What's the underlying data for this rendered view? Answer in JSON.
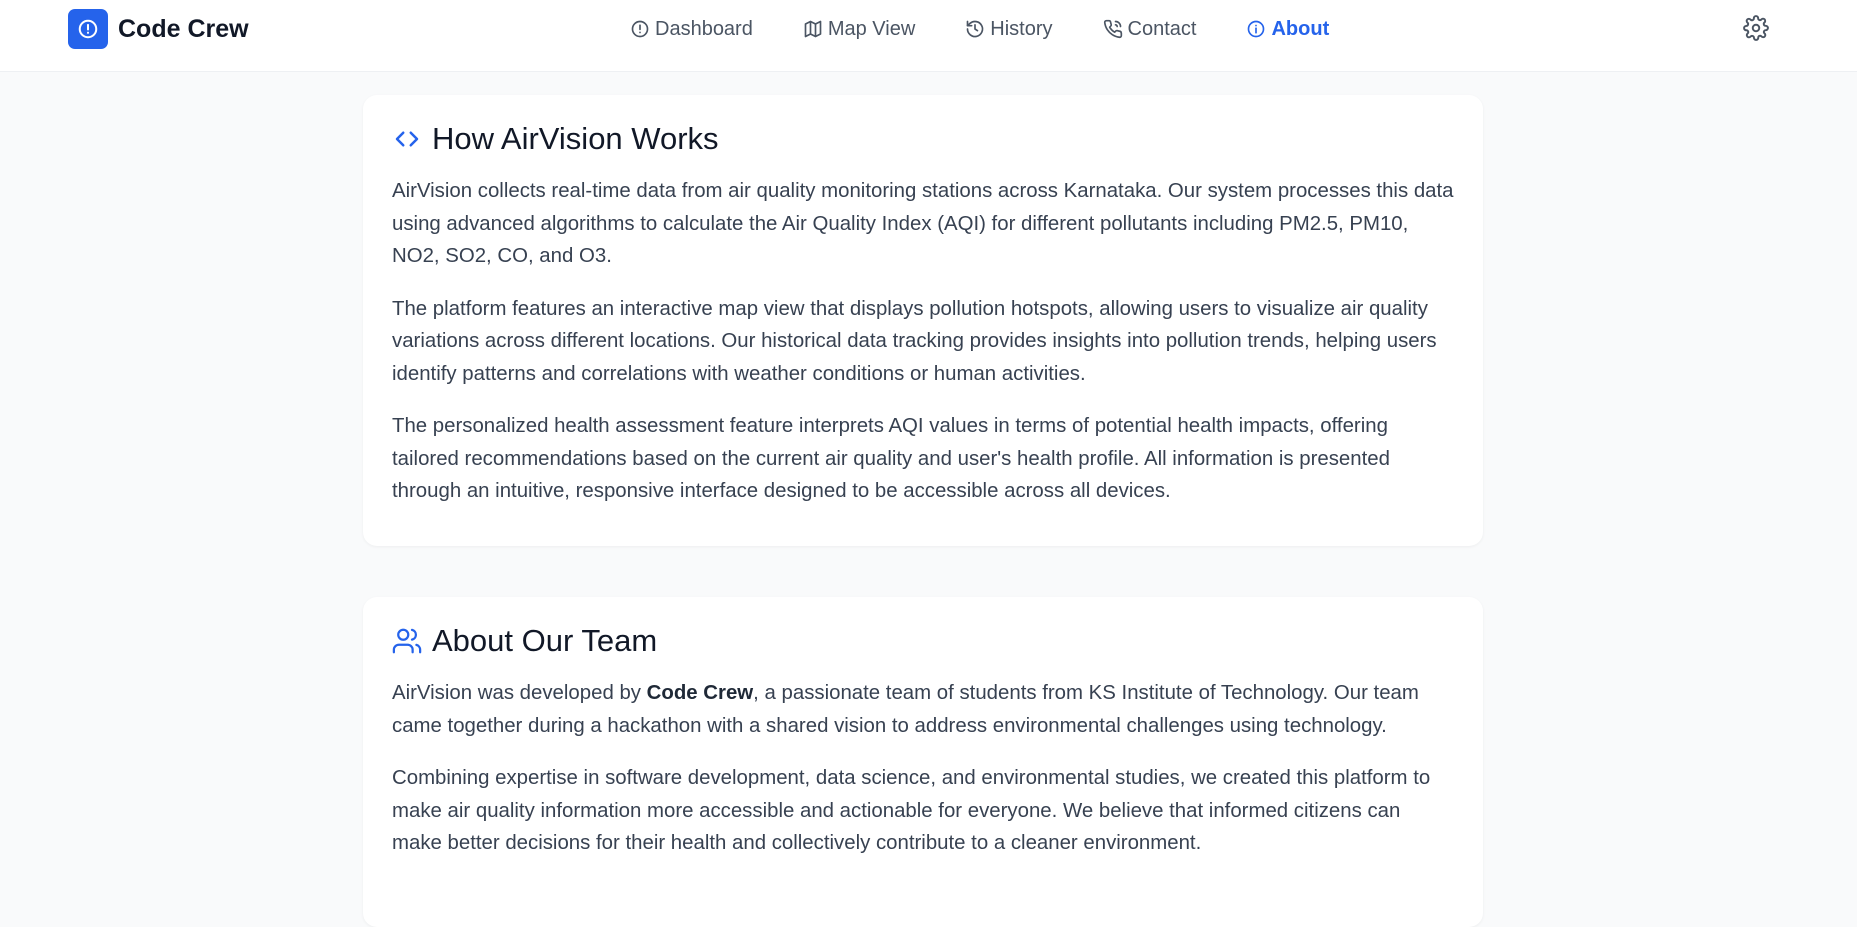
{
  "brand": {
    "name": "Code Crew",
    "logo_icon": "alert-circle-icon"
  },
  "nav": {
    "items": [
      {
        "label": "Dashboard",
        "icon": "alert-circle-icon",
        "active": false
      },
      {
        "label": "Map View",
        "icon": "map-icon",
        "active": false
      },
      {
        "label": "History",
        "icon": "history-icon",
        "active": false
      },
      {
        "label": "Contact",
        "icon": "phone-icon",
        "active": false
      },
      {
        "label": "About",
        "icon": "info-icon",
        "active": true
      }
    ],
    "settings_icon": "gear-icon"
  },
  "colors": {
    "accent": "#2563eb",
    "background": "#f9fafb",
    "card": "#ffffff",
    "text": "#374151",
    "heading": "#111827"
  },
  "how_it_works": {
    "icon": "code-icon",
    "title": "How AirVision Works",
    "paragraphs": [
      "AirVision collects real-time data from air quality monitoring stations across Karnataka. Our system processes this data using advanced algorithms to calculate the Air Quality Index (AQI) for different pollutants including PM2.5, PM10, NO2, SO2, CO, and O3.",
      "The platform features an interactive map view that displays pollution hotspots, allowing users to visualize air quality variations across different locations. Our historical data tracking provides insights into pollution trends, helping users identify patterns and correlations with weather conditions or human activities.",
      "The personalized health assessment feature interprets AQI values in terms of potential health impacts, offering tailored recommendations based on the current air quality and user's health profile. All information is presented through an intuitive, responsive interface designed to be accessible across all devices."
    ]
  },
  "team": {
    "icon": "users-icon",
    "title": "About Our Team",
    "p1_before": "AirVision was developed by ",
    "p1_bold": "Code Crew",
    "p1_after": ", a passionate team of students from KS Institute of Technology. Our team came together during a hackathon with a shared vision to address environmental challenges using technology.",
    "p2": "Combining expertise in software development, data science, and environmental studies, we created this platform to make air quality information more accessible and actionable for everyone. We believe that informed citizens can make better decisions for their health and collectively contribute to a cleaner environment."
  }
}
